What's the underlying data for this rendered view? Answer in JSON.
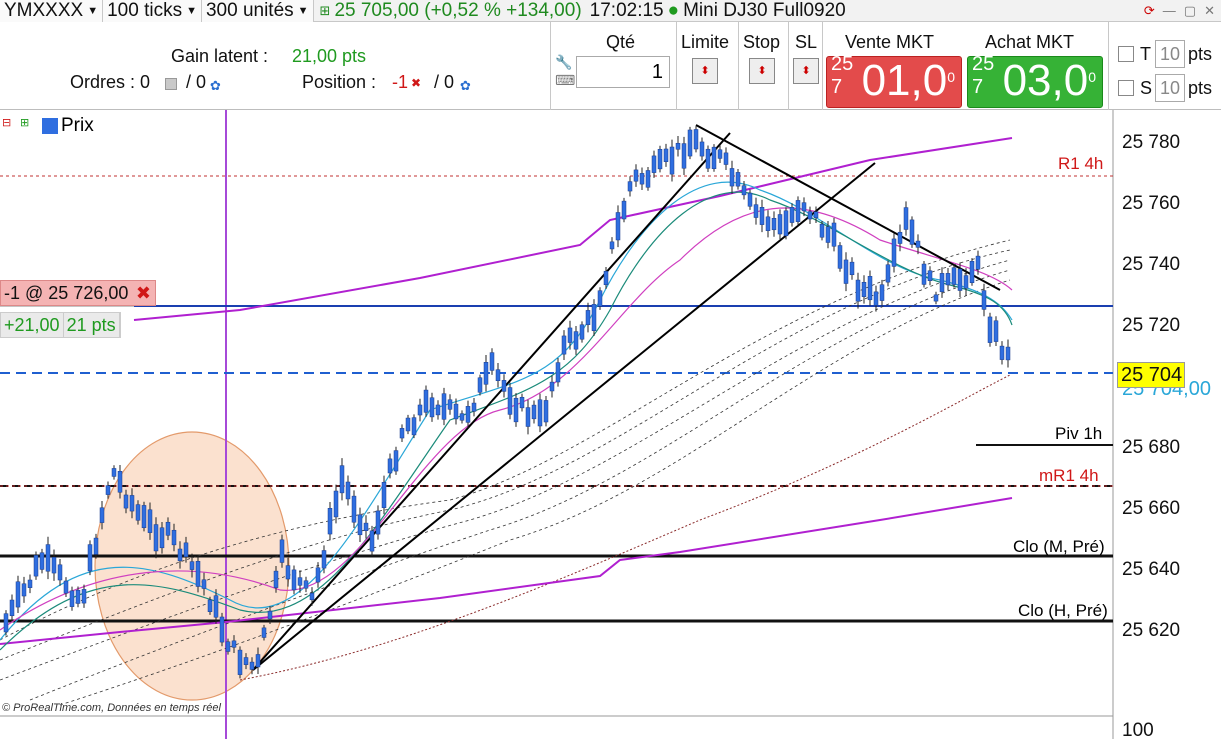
{
  "topbar": {
    "symbol": "YMXXXX",
    "ticks": "100 ticks",
    "units": "300 unités",
    "last_price": "25 705,00 (+0,52 % +134,00)",
    "time": "17:02:15",
    "instrument": "Mini DJ30 Full0920"
  },
  "panel": {
    "gain_label": "Gain latent :",
    "gain_value": "21,00 pts",
    "orders_label": "Ordres : 0",
    "orders_sep": "/ 0",
    "position_label": "Position :",
    "position_value": "-1",
    "position_sep": "/ 0",
    "qty_header": "Qté",
    "qty_value": "1",
    "limit_header": "Limite",
    "stop_header": "Stop",
    "sl_header": "SL",
    "sell_header": "Vente MKT",
    "buy_header": "Achat MKT",
    "sell_prefix": "25 7",
    "sell_big": "01,0",
    "sell_sup": "0",
    "buy_prefix": "25 7",
    "buy_big": "03,0",
    "buy_sup": "0",
    "t_label": "T",
    "t_value": "10",
    "t_unit": "pts",
    "s_label": "S",
    "s_value": "10",
    "s_unit": "pts"
  },
  "chart": {
    "legend": "Prix",
    "position_tag": "-1 @ 25 726,00",
    "pl_value": "+21,00",
    "pl_pts": "21 pts",
    "current_price": "25 704",
    "current_price_2": "25 704,00",
    "r1_label": "R1 4h",
    "piv_label": "Piv 1h",
    "mr_label": "mR1 4h",
    "clo_m_label": "Clo (M, Pré)",
    "clo_h_label": "Clo (H, Pré)",
    "copyright": "© ProRealTime.com, Données en temps réel",
    "axis_ticks": [
      "25 780",
      "25 760",
      "25 740",
      "25 720",
      "25 680",
      "25 660",
      "25 640",
      "25 620",
      "100"
    ],
    "accent_up": "#36b236",
    "accent_down": "#e34b4b",
    "candle_color": "#2f6ee0"
  }
}
